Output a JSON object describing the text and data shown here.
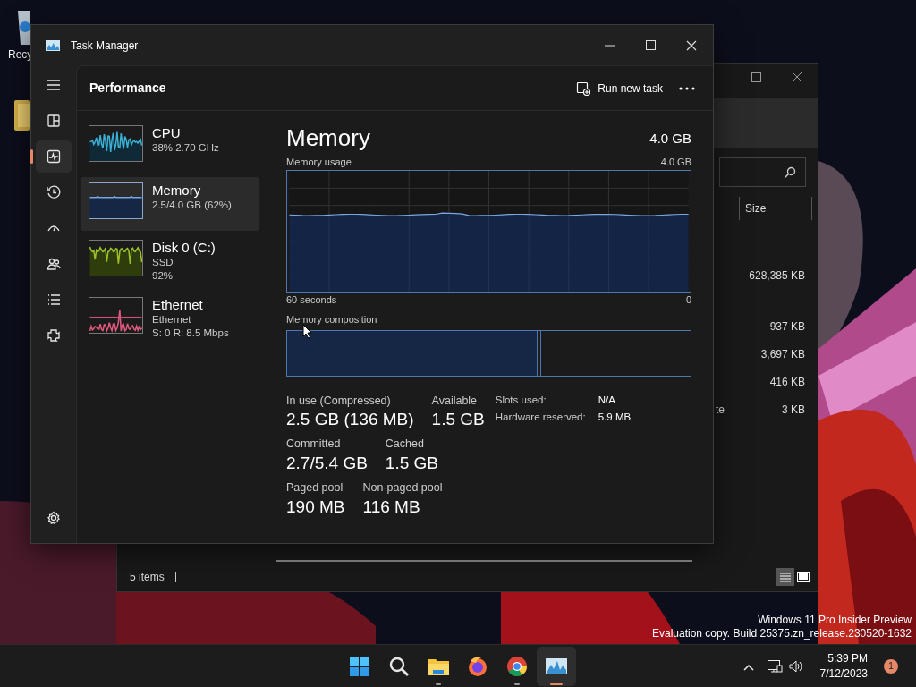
{
  "desktop": {
    "icons": [
      {
        "kind": "recycle-bin",
        "label": "Recy"
      },
      {
        "kind": "folder"
      }
    ],
    "notice": [
      "Windows 11 Pro Insider Preview",
      "Evaluation copy. Build 25375.zn_release.230520-1632"
    ]
  },
  "explorer": {
    "size_header": "Size",
    "rows": [
      {
        "size": "628,385 KB"
      },
      {
        "size": "937 KB"
      },
      {
        "size": "3,697 KB"
      },
      {
        "size": "416 KB"
      },
      {
        "name": "te",
        "size": "3 KB"
      }
    ],
    "status": "5 items"
  },
  "task_manager": {
    "title": "Task Manager",
    "page": "Performance",
    "run_new_task": "Run new task",
    "nav": [
      {
        "kind": "menu",
        "selected": false
      },
      {
        "kind": "processes",
        "selected": false
      },
      {
        "kind": "performance",
        "selected": true
      },
      {
        "kind": "history",
        "selected": false
      },
      {
        "kind": "startup",
        "selected": false
      },
      {
        "kind": "users",
        "selected": false
      },
      {
        "kind": "details",
        "selected": false
      },
      {
        "kind": "services",
        "selected": false
      },
      {
        "kind": "settings",
        "selected": false
      }
    ],
    "devices": [
      {
        "kind": "cpu",
        "name": "CPU",
        "lines": [
          "38% 2.70 GHz"
        ],
        "color": "#3ab0d6",
        "selected": false
      },
      {
        "kind": "memory",
        "name": "Memory",
        "lines": [
          "2.5/4.0 GB (62%)"
        ],
        "color": "#7aa7e0",
        "selected": true
      },
      {
        "kind": "disk",
        "name": "Disk 0 (C:)",
        "lines": [
          "SSD",
          "92%"
        ],
        "color": "#9cc22a",
        "selected": false
      },
      {
        "kind": "network",
        "name": "Ethernet",
        "lines": [
          "Ethernet",
          "S: 0 R: 8.5 Mbps"
        ],
        "color": "#e0587f",
        "selected": false
      }
    ],
    "detail": {
      "title": "Memory",
      "total": "4.0 GB",
      "usage_label": "Memory usage",
      "usage_max": "4.0 GB",
      "time_start": "60 seconds",
      "time_end": "0",
      "composition_label": "Memory composition",
      "composition": {
        "level": 0.62
      },
      "stats": [
        [
          {
            "label": "In use (Compressed)",
            "value": "2.5 GB (136 MB)"
          },
          {
            "label": "Available",
            "value": "1.5 GB"
          }
        ],
        [
          {
            "label": "Committed",
            "value": "2.7/5.4 GB"
          },
          {
            "label": "Cached",
            "value": "1.5 GB"
          }
        ],
        [
          {
            "label": "Paged pool",
            "value": "190 MB"
          },
          {
            "label": "Non-paged pool",
            "value": "116 MB"
          }
        ]
      ],
      "side_stats": [
        {
          "label": "Slots used:",
          "value": "N/A"
        },
        {
          "label": "Hardware reserved:",
          "value": "5.9 MB"
        }
      ]
    }
  },
  "taskbar": {
    "apps": [
      {
        "kind": "start",
        "running": false,
        "selected": false
      },
      {
        "kind": "search",
        "running": false,
        "selected": false
      },
      {
        "kind": "explorer",
        "running": true,
        "selected": false
      },
      {
        "kind": "firefox",
        "running": false,
        "selected": false
      },
      {
        "kind": "chrome",
        "running": true,
        "selected": false
      },
      {
        "kind": "taskmgr",
        "running": true,
        "selected": true
      }
    ],
    "time": "5:39 PM",
    "date": "7/12/2023",
    "notifications": "1"
  }
}
